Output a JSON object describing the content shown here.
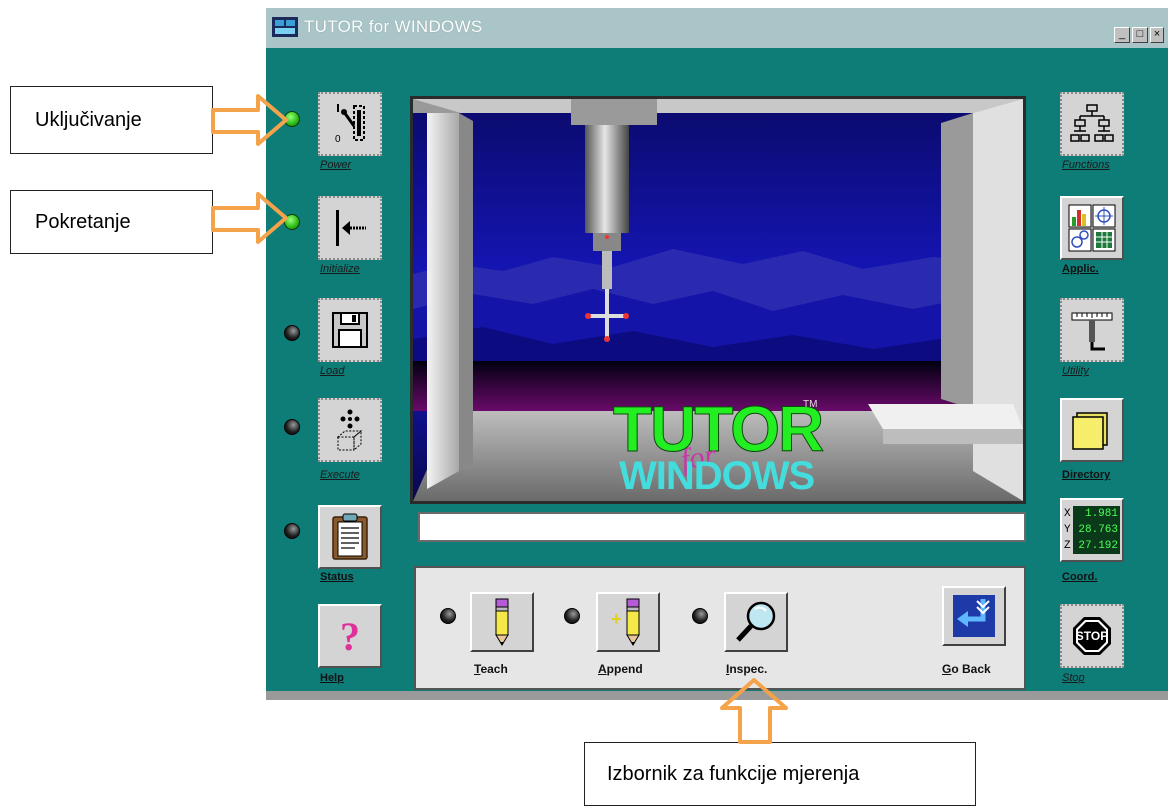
{
  "window": {
    "title": "TUTOR for WINDOWS",
    "controls": {
      "minimize": "_",
      "maximize": "□",
      "close": "×"
    }
  },
  "left_buttons": [
    {
      "label": "Power",
      "icon": "power-switch-icon",
      "led": "on"
    },
    {
      "label": "Initialize",
      "icon": "arrow-to-wall-icon",
      "led": "on"
    },
    {
      "label": "Load",
      "icon": "floppy-disk-icon",
      "led": "off"
    },
    {
      "label": "Execute",
      "icon": "execute-cube-icon",
      "led": "off"
    },
    {
      "label": "Status",
      "icon": "clipboard-icon",
      "led": "off"
    },
    {
      "label": "Help",
      "icon": "question-mark-icon"
    }
  ],
  "right_buttons": [
    {
      "label": "Functions",
      "icon": "hierarchy-tree-icon"
    },
    {
      "label": "Applic.",
      "icon": "applications-grid-icon"
    },
    {
      "label": "Utility",
      "icon": "ruler-tool-icon"
    },
    {
      "label": "Directory",
      "icon": "folder-icon"
    },
    {
      "label": "Coord.",
      "icon": "coordinates-display-icon"
    },
    {
      "label": "Stop",
      "icon": "stop-sign-icon"
    }
  ],
  "coordinates": {
    "x_axis": "X",
    "x_value": "1.981",
    "y_axis": "Y",
    "y_value": "28.763",
    "z_axis": "Z",
    "z_value": "27.192"
  },
  "stop_sign_text": "STOP",
  "help_glyph": "?",
  "splash": {
    "line1": "TUTOR",
    "line2": "for",
    "line3": "WINDOWS",
    "tm": "TM"
  },
  "status_text": "",
  "measure_menu": [
    {
      "label_key": "T",
      "label_rest": "each",
      "icon": "pencil-icon",
      "led": "off"
    },
    {
      "label_key": "A",
      "label_rest": "ppend",
      "icon": "pencil-plus-icon",
      "led": "off"
    },
    {
      "label_key": "I",
      "label_rest": "nspec.",
      "icon": "magnifier-icon",
      "led": "off"
    },
    {
      "label_key": "G",
      "label_rest": "o Back",
      "icon": "go-back-arrow-icon"
    }
  ],
  "annotations": {
    "power_on": "Uključivanje",
    "start": "Pokretanje",
    "measure_menu": "Izbornik za funkcije mjerenja"
  },
  "colors": {
    "window_bg": "#0e7d78",
    "titlebar": "#a9c5c7",
    "arrow": "#f5a34a",
    "led_on": "#2fbf1b",
    "splash_green": "#22ee22",
    "splash_cyan": "#44dddd",
    "splash_magenta": "#cc33aa"
  }
}
